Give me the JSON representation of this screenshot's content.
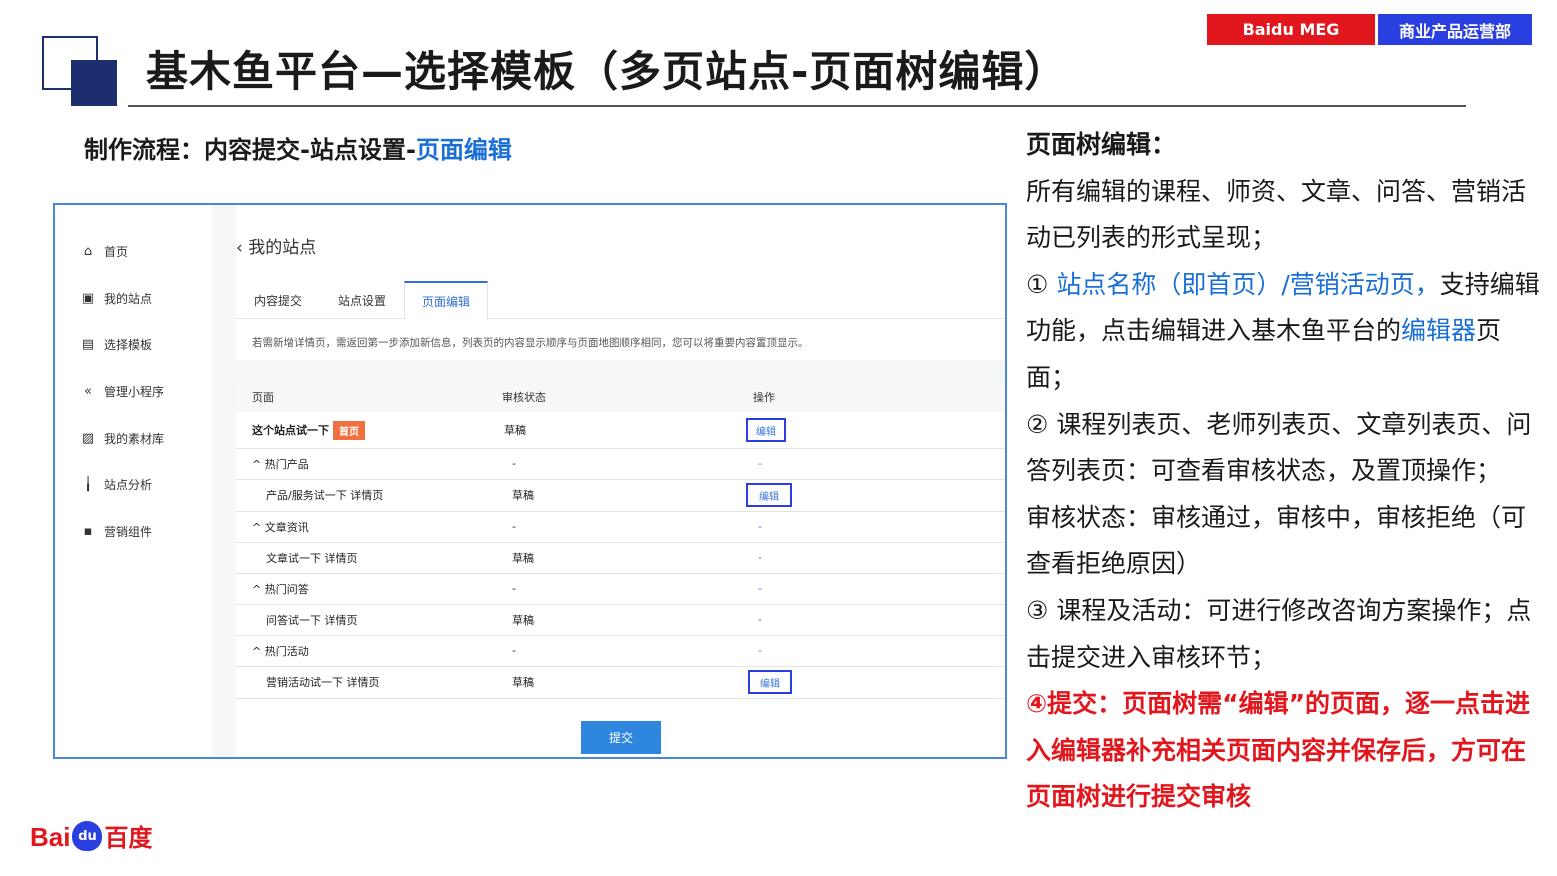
{
  "header": {
    "title": "基木鱼平台—选择模板（多页站点-页面树编辑）",
    "brand_left": "Baidu MEG",
    "brand_right": "商业产品运营部",
    "colors": {
      "brand_red": "#e2161d",
      "brand_blue": "#2a3fe0",
      "deco_navy": "#1c2e6e"
    }
  },
  "subtitle": {
    "prefix": "制作流程：内容提交-站点设置-",
    "highlight": "页面编辑"
  },
  "screenshot": {
    "sidebar": [
      {
        "icon": "home-icon",
        "glyph": "⌂",
        "label": "首页"
      },
      {
        "icon": "monitor-icon",
        "glyph": "▣",
        "label": "我的站点"
      },
      {
        "icon": "template-icon",
        "glyph": "▤",
        "label": "选择模板"
      },
      {
        "icon": "code-icon",
        "glyph": "«",
        "label": "管理小程序"
      },
      {
        "icon": "image-icon",
        "glyph": "▨",
        "label": "我的素材库"
      },
      {
        "icon": "chart-icon",
        "glyph": "╽",
        "label": "站点分析"
      },
      {
        "icon": "component-icon",
        "glyph": "▪",
        "label": "营销组件"
      }
    ],
    "back": "我的站点",
    "tabs": [
      "内容提交",
      "站点设置",
      "页面编辑"
    ],
    "notice": "若需新增详情页，需返回第一步添加新信息，列表页的内容显示顺序与页面地图顺序相同，您可以将重要内容置顶显示。",
    "columns": [
      "页面",
      "审核状态",
      "操作"
    ],
    "rows": [
      {
        "page": "这个站点试一下",
        "badge": "首页",
        "status": "草稿",
        "op": "编辑"
      },
      {
        "page": "^ 热门产品",
        "status": "-",
        "op": "-"
      },
      {
        "page": "产品/服务试一下 详情页",
        "status": "草稿",
        "op": "编辑"
      },
      {
        "page": "^ 文章资讯",
        "status": "-",
        "op": "-"
      },
      {
        "page": "文章试一下 详情页",
        "status": "草稿",
        "op": "-"
      },
      {
        "page": "^ 热门问答",
        "status": "-",
        "op": "-"
      },
      {
        "page": "问答试一下 详情页",
        "status": "草稿",
        "op": "-"
      },
      {
        "page": "^ 热门活动",
        "status": "-",
        "op": "-"
      },
      {
        "page": "营销活动试一下 详情页",
        "status": "草稿",
        "op": "编辑"
      }
    ],
    "submit": "提交"
  },
  "right_text": {
    "heading": "页面树编辑：",
    "p1": "所有编辑的课程、师资、文章、问答、营销活动已列表的形式呈现；",
    "p2_a": "① ",
    "p2_b": "站点名称（即首页）/营销活动页，",
    "p2_c": "支持编辑功能，点击编辑进入基木鱼平台的",
    "p2_d": "编辑器",
    "p2_e": "页面；",
    "p3": "② 课程列表页、老师列表页、文章列表页、问答列表页：可查看审核状态，及置顶操作；",
    "p4": "审核状态：审核通过，审核中，审核拒绝（可查看拒绝原因）",
    "p5": "③ 课程及活动：可进行修改咨询方案操作；点击提交进入审核环节；",
    "p6": "④提交：页面树需“编辑”的页面，逐一点击进入编辑器补充相关页面内容并保存后，方可在页面树进行提交审核"
  },
  "logo": {
    "bai": "Bai",
    "du": "du",
    "cn": "百度"
  }
}
